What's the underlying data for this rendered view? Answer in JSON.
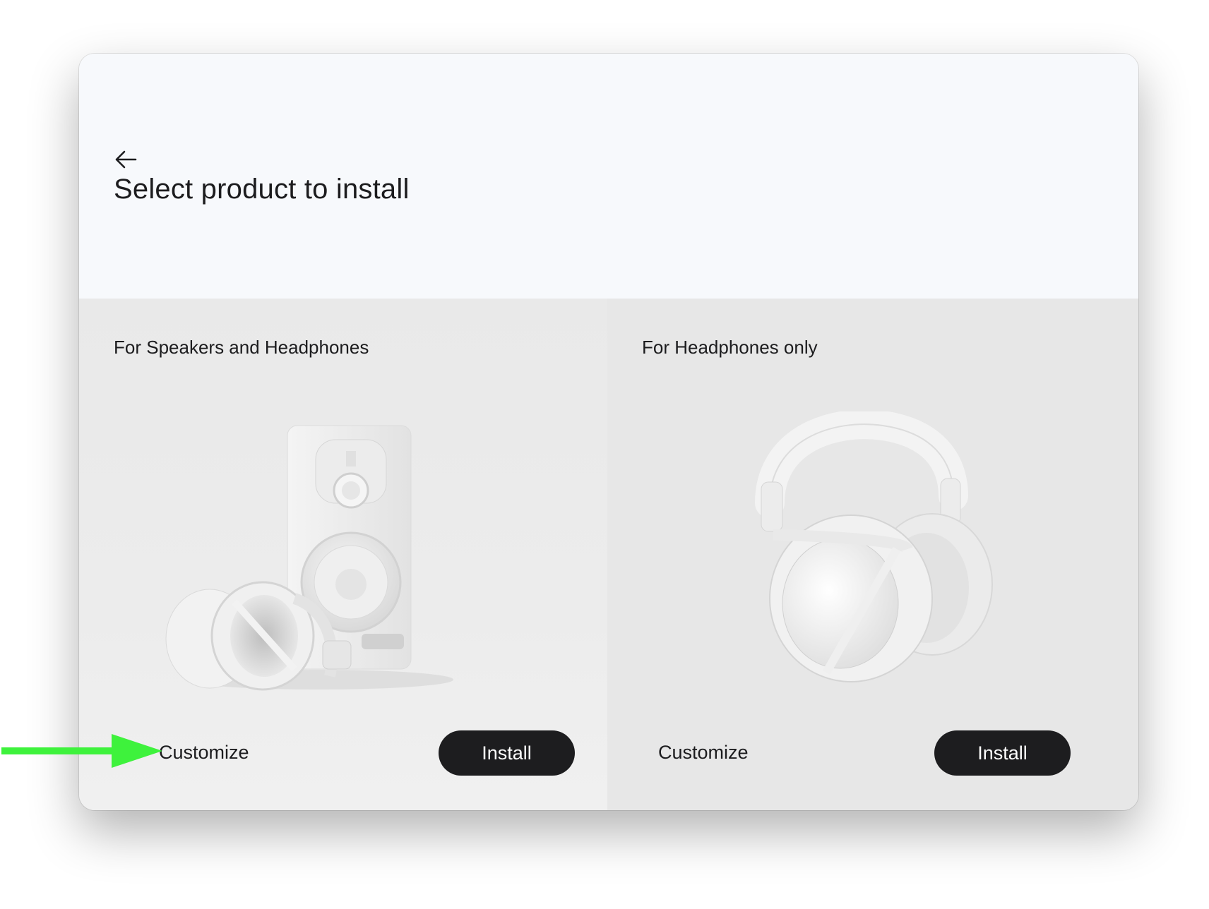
{
  "window": {
    "close_color": "#fe5f57"
  },
  "header": {
    "back_icon": "arrow-left-icon",
    "title": "Select product to install"
  },
  "products": [
    {
      "title": "For Speakers and Headphones",
      "illustration": "speaker-and-headphones-image",
      "customize_label": "Customize",
      "install_label": "Install"
    },
    {
      "title": "For Headphones only",
      "illustration": "headphones-image",
      "customize_label": "Customize",
      "install_label": "Install"
    }
  ],
  "annotation": {
    "arrow_color": "#3ef23c",
    "target": "Customize"
  }
}
